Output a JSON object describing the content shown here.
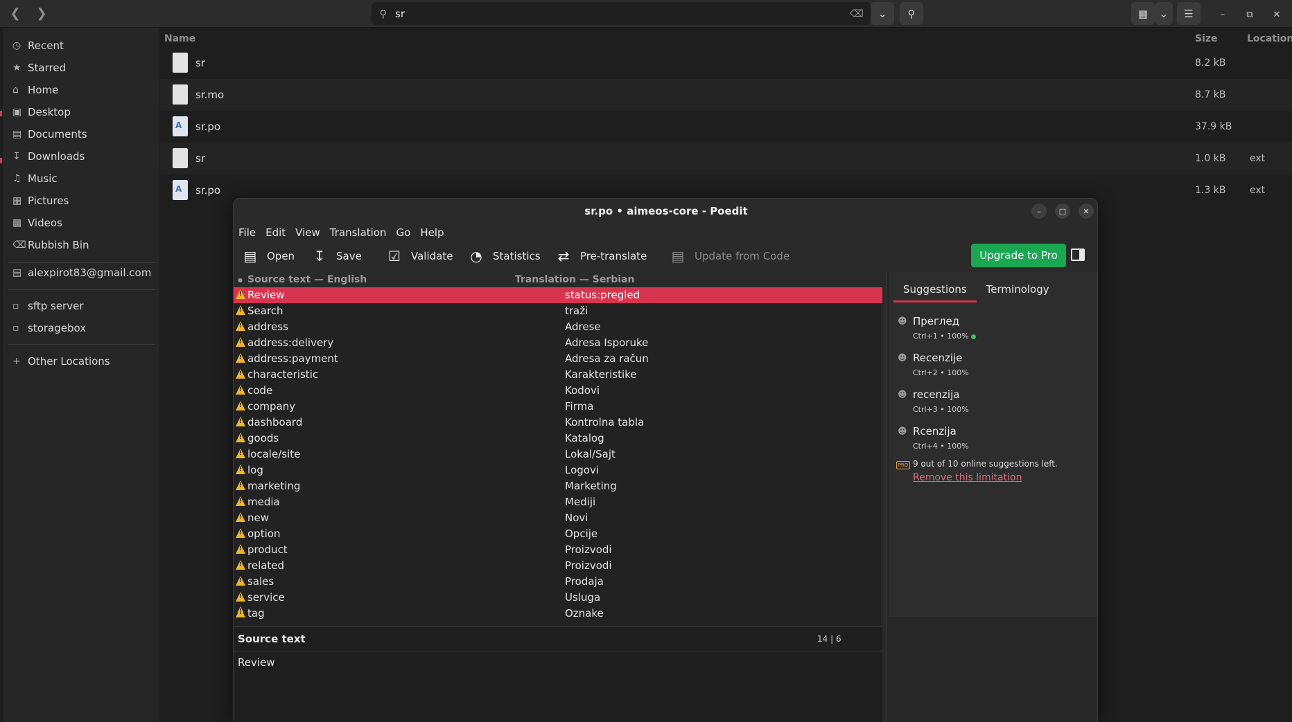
{
  "file_manager": {
    "search": {
      "value": "sr"
    },
    "sidebar": {
      "items": [
        {
          "label": "Recent",
          "icon": "clock-icon"
        },
        {
          "label": "Starred",
          "icon": "star-icon"
        },
        {
          "label": "Home",
          "icon": "home-icon"
        },
        {
          "label": "Desktop",
          "icon": "desktop-icon"
        },
        {
          "label": "Documents",
          "icon": "documents-icon"
        },
        {
          "label": "Downloads",
          "icon": "download-icon"
        },
        {
          "label": "Music",
          "icon": "music-icon"
        },
        {
          "label": "Pictures",
          "icon": "pictures-icon"
        },
        {
          "label": "Videos",
          "icon": "videos-icon"
        },
        {
          "label": "Rubbish Bin",
          "icon": "trash-icon"
        }
      ],
      "account": "alexpirot83@gmail.com",
      "network": [
        {
          "label": "sftp server"
        },
        {
          "label": "storagebox"
        }
      ],
      "other_locations": "Other Locations"
    },
    "columns": {
      "name": "Name",
      "size": "Size",
      "location": "Location"
    },
    "files": [
      {
        "name": "sr",
        "size": "8.2 kB",
        "location": "",
        "type": "generic"
      },
      {
        "name": "sr.mo",
        "size": "8.7 kB",
        "location": "",
        "type": "generic"
      },
      {
        "name": "sr.po",
        "size": "37.9 kB",
        "location": "",
        "type": "po"
      },
      {
        "name": "sr",
        "size": "1.0 kB",
        "location": "ext",
        "type": "generic"
      },
      {
        "name": "sr.po",
        "size": "1.3 kB",
        "location": "ext",
        "type": "po"
      }
    ]
  },
  "poedit": {
    "title": "sr.po • aimeos-core - Poedit",
    "menu": [
      "File",
      "Edit",
      "View",
      "Translation",
      "Go",
      "Help"
    ],
    "toolbar": {
      "open": "Open",
      "save": "Save",
      "validate": "Validate",
      "statistics": "Statistics",
      "pretranslate": "Pre-translate",
      "update": "Update from Code",
      "upgrade": "Upgrade to Pro"
    },
    "list_headers": {
      "source": "Source text — English",
      "translation": "Translation — Serbian"
    },
    "entries": [
      {
        "src": "Review",
        "dst": "status:pregled"
      },
      {
        "src": "Search",
        "dst": "traži"
      },
      {
        "src": "address",
        "dst": "Adrese"
      },
      {
        "src": "address:delivery",
        "dst": "Adresa Isporuke"
      },
      {
        "src": "address:payment",
        "dst": "Adresa za račun"
      },
      {
        "src": "characteristic",
        "dst": "Karakteristike"
      },
      {
        "src": "code",
        "dst": "Kodovi"
      },
      {
        "src": "company",
        "dst": "Firma"
      },
      {
        "src": "dashboard",
        "dst": "Kontrolna tabla"
      },
      {
        "src": "goods",
        "dst": "Katalog"
      },
      {
        "src": "locale/site",
        "dst": "Lokal/Sajt"
      },
      {
        "src": "log",
        "dst": "Logovi"
      },
      {
        "src": "marketing",
        "dst": "Marketing"
      },
      {
        "src": "media",
        "dst": "Mediji"
      },
      {
        "src": "new",
        "dst": "Novi"
      },
      {
        "src": "option",
        "dst": "Opcije"
      },
      {
        "src": "product",
        "dst": "Proizvodi"
      },
      {
        "src": "related",
        "dst": "Proizvodi"
      },
      {
        "src": "sales",
        "dst": "Prodaja"
      },
      {
        "src": "service",
        "dst": "Usluga"
      },
      {
        "src": "tag",
        "dst": "Oznake"
      }
    ],
    "source_panel": {
      "label": "Source text",
      "counts": "14 | 6",
      "value": "Review"
    },
    "side_tabs": [
      "Suggestions",
      "Terminology"
    ],
    "suggestions": [
      {
        "text": "Преглед",
        "meta": "Ctrl+1 • 100%"
      },
      {
        "text": "Recenzije",
        "meta": "Ctrl+2 • 100%"
      },
      {
        "text": "recenzija",
        "meta": "Ctrl+3 • 100%"
      },
      {
        "text": "Rcenzija",
        "meta": "Ctrl+4 • 100%"
      }
    ],
    "pro_badge": "PRO",
    "limit_text": "9 out of 10 online suggestions left.",
    "limit_link": "Remove this limitation"
  }
}
